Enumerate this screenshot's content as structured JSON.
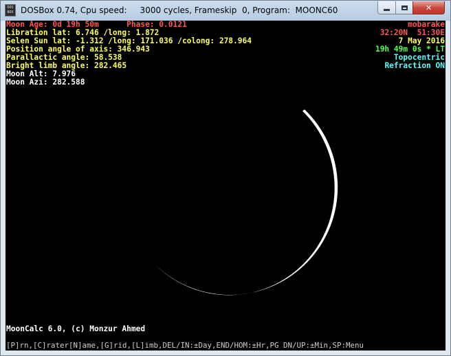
{
  "window": {
    "title": "DOSBox 0.74, Cpu speed:     3000 cycles, Frameskip  0, Program:  MOONC60",
    "icon_text_top": "DOS",
    "icon_text_bottom": "BOX",
    "icon": "dosbox-icon",
    "controls": {
      "minimize": "minimize-icon",
      "maximize": "maximize-icon",
      "close_label": "✕"
    }
  },
  "info_left": {
    "moon_age": "Moon Age: 0d 19h 50m      Phase: 0.0121",
    "libration": "Libration lat: 6.746 /long: 1.872",
    "selen_sun": "Selen Sun lat: -1.312 /long: 171.036 /colong: 278.964",
    "position_angle": "Position angle of axis: 346.943",
    "parallactic": "Parallactic angle: 58.538",
    "bright_limb": "Bright limb angle: 282.465",
    "moon_alt": "Moon Alt: 7.976",
    "moon_azi": "Moon Azi: 282.588"
  },
  "info_right": {
    "location": "mobarake",
    "coords": "32:20N  51:30E",
    "date": "7 May 2016",
    "time": "19h 49m 0s * LT",
    "mode": "Topocentric",
    "refraction": "Refraction ON"
  },
  "credits": "MoonCalc 6.0, (c) Monzur Ahmed",
  "help_bar": "[P]rn,[C]rater[N]ame,[G]rid,[L]imb,DEL/IN:±Day,END/HOM:±Hr,PG DN/UP:±Min,SP:Menu",
  "colors": {
    "red": "#ff5555",
    "yellow": "#ffff55",
    "green": "#55ff55",
    "cyan": "#55ffff",
    "white": "#ffffff",
    "background": "#000000"
  }
}
